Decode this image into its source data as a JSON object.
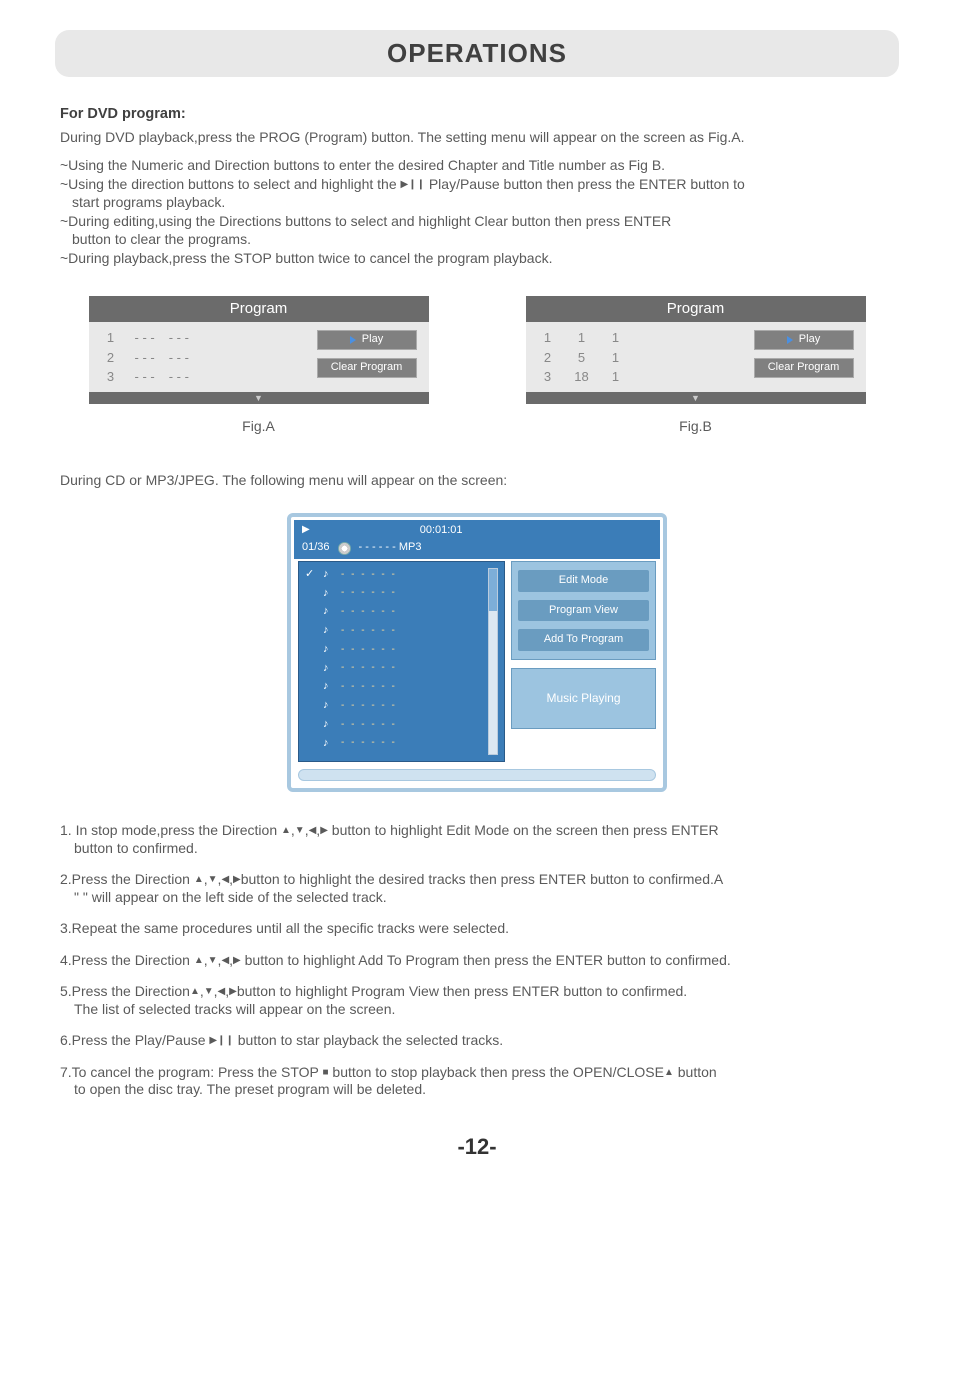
{
  "header": {
    "title": "OPERATIONS"
  },
  "dvd": {
    "title": "For DVD program:",
    "intro": "During DVD playback,press the PROG (Program) button. The setting menu will appear on the screen as Fig.A.",
    "b1": "~Using  the  Numeric and Direction buttons  to  enter  the  desired  Chapter  and  Title  number  as  Fig B.",
    "b2a": "~Using the direction buttons to select and highlight the ",
    "b2b": " Play/Pause button then press the ENTER button to",
    "b2c": "start programs playback.",
    "b3a": "~During editing,using the Directions buttons  to select and highlight Clear button then press ENTER",
    "b3b": "button to clear the programs.",
    "b4": "~During playback,press the STOP button twice to cancel the program playback."
  },
  "figA": {
    "header": "Program",
    "rows": [
      {
        "n": "1",
        "a": "- - -",
        "b": "- - -"
      },
      {
        "n": "2",
        "a": "- - -",
        "b": "- - -"
      },
      {
        "n": "3",
        "a": "- - -",
        "b": "- - -"
      }
    ],
    "play": "Play",
    "clear": "Clear  Program",
    "caption": "Fig.A"
  },
  "figB": {
    "header": "Program",
    "rows": [
      {
        "n": "1",
        "a": "1",
        "b": "1"
      },
      {
        "n": "2",
        "a": "5",
        "b": "1"
      },
      {
        "n": "3",
        "a": "18",
        "b": "1"
      }
    ],
    "play": "Play",
    "clear": "Clear  Program",
    "caption": "Fig.B"
  },
  "cd": {
    "intro": "During CD or MP3/JPEG.  The following menu will appear on the screen:"
  },
  "mp3": {
    "time": "00:01:01",
    "counter": "01/36",
    "format": "- - - - - - MP3",
    "edit": "Edit  Mode",
    "pview": "Program View",
    "add": "Add To Program",
    "playing": "Music Playing",
    "dashline": "- - - - - -"
  },
  "steps": {
    "s1a": "1.  In stop mode,press the Direction ",
    "s1b": " button to highlight   Edit Mode   on the screen then press ENTER",
    "s1c": "button to confirmed.",
    "s2a": "2.Press the Direction ",
    "s2b": "button to highlight the desired tracks then press ENTER button to confirmed.A",
    "s2c": "\"     \" will appear on the left side of the selected track.",
    "s3": "3.Repeat the same  procedures until all the specific tracks were selected.",
    "s4a": "4.Press the Direction ",
    "s4b": " button to highlight  Add To Program  then press the ENTER button to confirmed.",
    "s5a": "5.Press the Direction",
    "s5b": "button to highlight  Program View  then press ENTER button to confirmed.",
    "s5c": "The list of selected tracks will appear on the screen.",
    "s6a": "6.Press the Play/Pause ",
    "s6b": " button to star playback the selected tracks.",
    "s7a": "7.To cancel the program: Press the STOP ",
    "s7b": " button to stop playback then press the OPEN/CLOSE",
    "s7c": "  button",
    "s7d": "to open the disc tray. The preset program will be deleted."
  },
  "page": "-12-",
  "glyphs": {
    "up": "▲",
    "down": "▼",
    "left": "◀",
    "right": "▶",
    "playpause": "▶❙❙",
    "stop": "■",
    "eject": "▲",
    "check": "✓"
  }
}
